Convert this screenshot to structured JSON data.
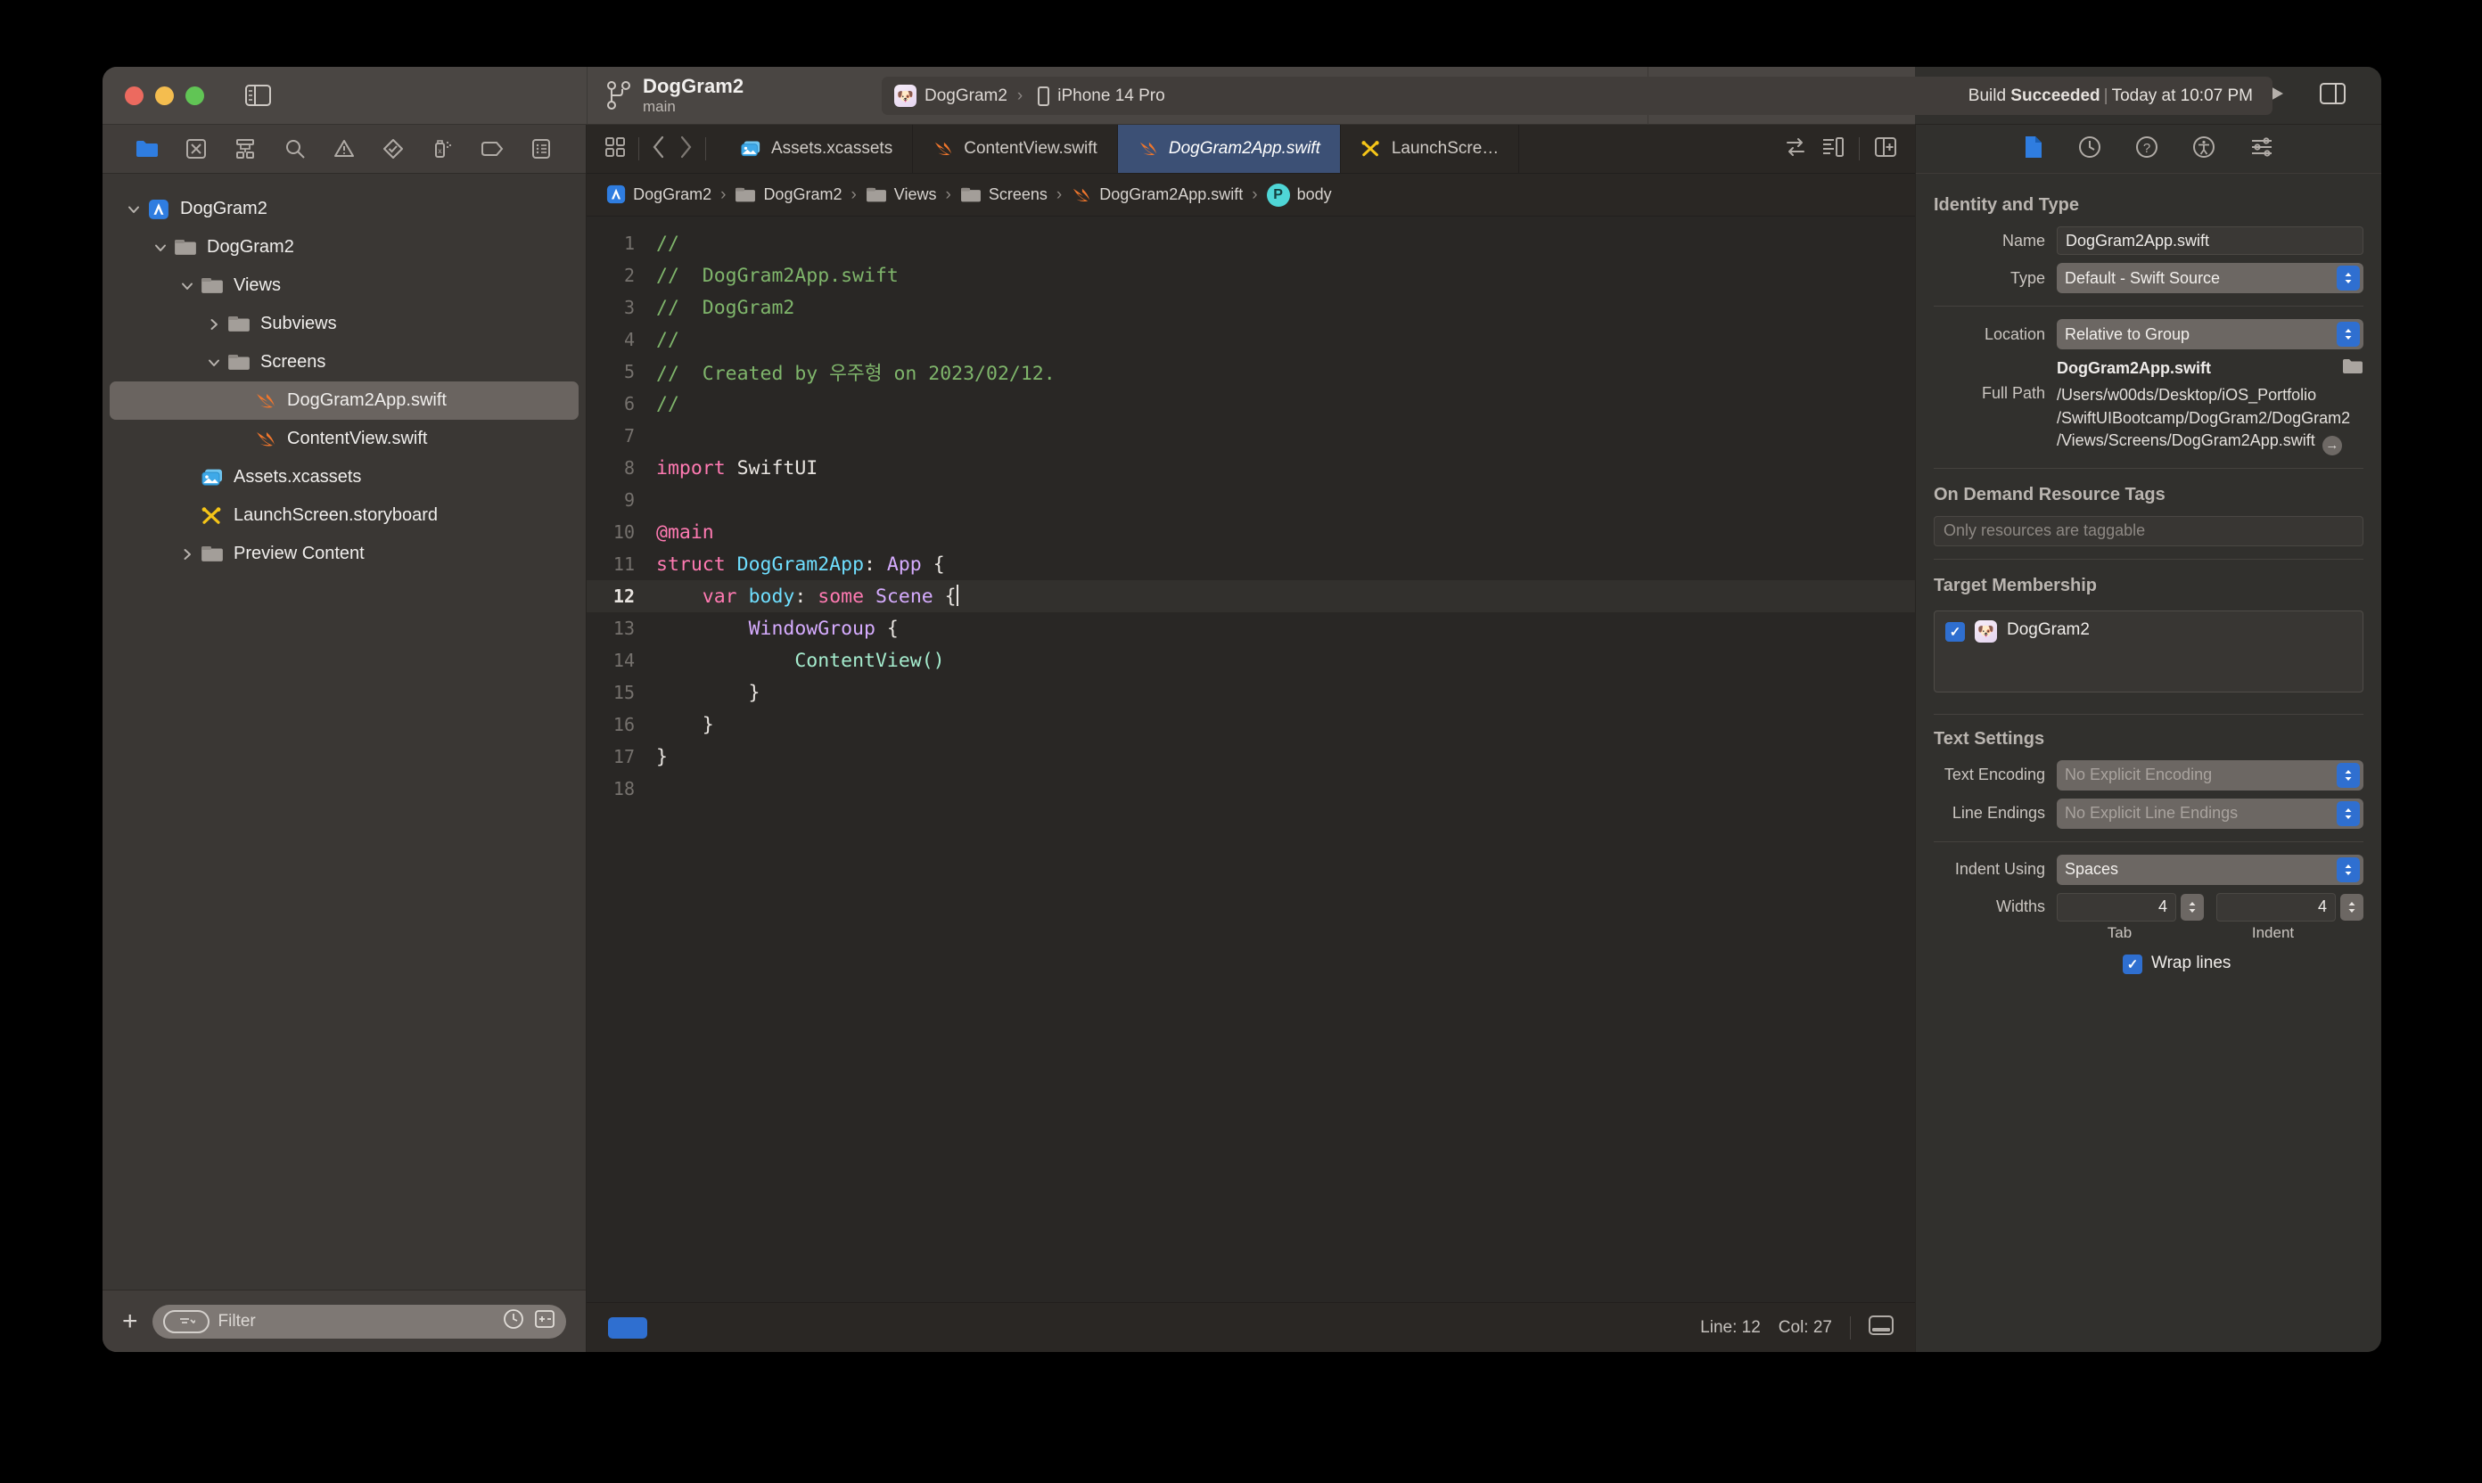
{
  "window": {
    "traffic_lights": [
      "close",
      "minimize",
      "zoom"
    ],
    "sidebar_toggle_icon": "sidebar-left-icon",
    "run_icon": "run-play-icon",
    "add_icon": "plus-icon",
    "inspector_toggle_icon": "sidebar-right-icon"
  },
  "toolbar": {
    "branch_icon": "source-control-branch-icon",
    "project_name": "DogGram2",
    "branch_name": "main",
    "scheme": {
      "app_icon": "doggram2-app-icon",
      "scheme_name": "DogGram2",
      "separator": "›",
      "device_icon": "iphone-device-icon",
      "destination": "iPhone 14 Pro"
    },
    "build_status": {
      "prefix": "Build ",
      "result": "Succeeded",
      "separator": "|",
      "time": "Today at 10:07 PM"
    }
  },
  "navigator": {
    "toolbar_icons": [
      "folder-project-navigator-icon",
      "source-control-navigator-icon",
      "symbol-navigator-icon",
      "find-navigator-icon",
      "issue-navigator-icon",
      "test-navigator-icon",
      "debug-navigator-icon",
      "breakpoint-navigator-icon",
      "report-navigator-icon"
    ],
    "tree": [
      {
        "label": "DogGram2",
        "icon": "xcode-project-icon",
        "twist": "down",
        "depth": 0,
        "selected": false
      },
      {
        "label": "DogGram2",
        "icon": "folder-icon",
        "twist": "down",
        "depth": 1,
        "selected": false
      },
      {
        "label": "Views",
        "icon": "folder-icon",
        "twist": "down",
        "depth": 2,
        "selected": false
      },
      {
        "label": "Subviews",
        "icon": "folder-icon",
        "twist": "right",
        "depth": 3,
        "selected": false
      },
      {
        "label": "Screens",
        "icon": "folder-icon",
        "twist": "down",
        "depth": 3,
        "selected": false
      },
      {
        "label": "DogGram2App.swift",
        "icon": "swift-file-icon",
        "twist": "none",
        "depth": 4,
        "selected": true
      },
      {
        "label": "ContentView.swift",
        "icon": "swift-file-icon",
        "twist": "none",
        "depth": 4,
        "selected": false
      },
      {
        "label": "Assets.xcassets",
        "icon": "assets-catalog-icon",
        "twist": "none",
        "depth": 2,
        "selected": false
      },
      {
        "label": "LaunchScreen.storyboard",
        "icon": "storyboard-icon",
        "twist": "none",
        "depth": 2,
        "selected": false
      },
      {
        "label": "Preview Content",
        "icon": "folder-icon",
        "twist": "right",
        "depth": 2,
        "selected": false
      }
    ],
    "filter": {
      "add_label": "+",
      "placeholder": "Filter",
      "filter_pill_icon": "filter-options-icon",
      "recent_icon": "recent-clock-icon",
      "sourcecontrol_icon": "show-modified-icon"
    }
  },
  "editor": {
    "nav_icons": [
      "grid-editor-options-icon",
      "back-chevron-icon",
      "forward-chevron-icon"
    ],
    "tabs": [
      {
        "label": "Assets.xcassets",
        "icon": "assets-catalog-icon",
        "active": false
      },
      {
        "label": "ContentView.swift",
        "icon": "swift-file-icon",
        "active": false
      },
      {
        "label": "DogGram2App.swift",
        "icon": "swift-file-icon",
        "active": true
      },
      {
        "label": "LaunchScre…",
        "icon": "storyboard-icon",
        "active": false
      }
    ],
    "tab_right_icons": [
      "code-review-toggle-icon",
      "minimap-toggle-icon",
      "add-editor-icon"
    ],
    "breadcrumb": [
      {
        "label": "DogGram2",
        "icon": "xcode-project-icon"
      },
      {
        "label": "DogGram2",
        "icon": "folder-icon"
      },
      {
        "label": "Views",
        "icon": "folder-icon"
      },
      {
        "label": "Screens",
        "icon": "folder-icon"
      },
      {
        "label": "DogGram2App.swift",
        "icon": "swift-file-icon"
      },
      {
        "label": "body",
        "icon": "property-badge-icon"
      }
    ],
    "code_lines": [
      {
        "n": "1",
        "tokens": [
          {
            "t": "//",
            "c": "cmt"
          }
        ],
        "hl": false
      },
      {
        "n": "2",
        "tokens": [
          {
            "t": "//  DogGram2App.swift",
            "c": "cmt"
          }
        ],
        "hl": false
      },
      {
        "n": "3",
        "tokens": [
          {
            "t": "//  DogGram2",
            "c": "cmt"
          }
        ],
        "hl": false
      },
      {
        "n": "4",
        "tokens": [
          {
            "t": "//",
            "c": "cmt"
          }
        ],
        "hl": false
      },
      {
        "n": "5",
        "tokens": [
          {
            "t": "//  Created by 우주형 on 2023/02/12.",
            "c": "cmt"
          }
        ],
        "hl": false
      },
      {
        "n": "6",
        "tokens": [
          {
            "t": "//",
            "c": "cmt"
          }
        ],
        "hl": false
      },
      {
        "n": "7",
        "tokens": [],
        "hl": false
      },
      {
        "n": "8",
        "tokens": [
          {
            "t": "import",
            "c": "kw"
          },
          {
            "t": " SwiftUI",
            "c": "pln"
          }
        ],
        "hl": false
      },
      {
        "n": "9",
        "tokens": [],
        "hl": false
      },
      {
        "n": "10",
        "tokens": [
          {
            "t": "@main",
            "c": "kw"
          }
        ],
        "hl": false
      },
      {
        "n": "11",
        "tokens": [
          {
            "t": "struct",
            "c": "kw"
          },
          {
            "t": " ",
            "c": "pln"
          },
          {
            "t": "DogGram2App",
            "c": "decl"
          },
          {
            "t": ": ",
            "c": "pln"
          },
          {
            "t": "App",
            "c": "typ"
          },
          {
            "t": " {",
            "c": "pln"
          }
        ],
        "hl": false
      },
      {
        "n": "12",
        "tokens": [
          {
            "t": "    ",
            "c": "pln"
          },
          {
            "t": "var",
            "c": "kw"
          },
          {
            "t": " ",
            "c": "pln"
          },
          {
            "t": "body",
            "c": "decl"
          },
          {
            "t": ": ",
            "c": "pln"
          },
          {
            "t": "some",
            "c": "kw"
          },
          {
            "t": " ",
            "c": "pln"
          },
          {
            "t": "Scene",
            "c": "typ"
          },
          {
            "t": " {",
            "c": "pln"
          }
        ],
        "hl": true,
        "caret": true
      },
      {
        "n": "13",
        "tokens": [
          {
            "t": "        ",
            "c": "pln"
          },
          {
            "t": "WindowGroup",
            "c": "typ"
          },
          {
            "t": " {",
            "c": "pln"
          }
        ],
        "hl": false
      },
      {
        "n": "14",
        "tokens": [
          {
            "t": "            ",
            "c": "pln"
          },
          {
            "t": "ContentView",
            "c": "fn"
          },
          {
            "t": "()",
            "c": "fn"
          }
        ],
        "hl": false
      },
      {
        "n": "15",
        "tokens": [
          {
            "t": "        }",
            "c": "pln"
          }
        ],
        "hl": false
      },
      {
        "n": "16",
        "tokens": [
          {
            "t": "    }",
            "c": "pln"
          }
        ],
        "hl": false
      },
      {
        "n": "17",
        "tokens": [
          {
            "t": "}",
            "c": "pln"
          }
        ],
        "hl": false
      },
      {
        "n": "18",
        "tokens": [],
        "hl": false
      }
    ],
    "status": {
      "line_label": "Line: 12",
      "col_label": "Col: 27",
      "debug_toggle_icon": "debug-area-toggle-icon",
      "activity_icon": "activity-indicator-icon"
    }
  },
  "inspector": {
    "tabs": [
      {
        "icon": "file-inspector-icon",
        "active": true
      },
      {
        "icon": "history-inspector-icon",
        "active": false
      },
      {
        "icon": "quick-help-inspector-icon",
        "active": false
      },
      {
        "icon": "accessibility-inspector-icon",
        "active": false
      },
      {
        "icon": "attributes-inspector-icon",
        "active": false
      }
    ],
    "identity": {
      "title": "Identity and Type",
      "name_label": "Name",
      "name_value": "DogGram2App.swift",
      "type_label": "Type",
      "type_value": "Default - Swift Source",
      "location_label": "Location",
      "location_value": "Relative to Group",
      "file_name": "DogGram2App.swift",
      "folder_icon": "choose-folder-icon",
      "fullpath_label": "Full Path",
      "fullpath_value": "/Users/w00ds/Desktop/iOS_Portfolio/SwiftUIBootcamp/DogGram2/DogGram2/Views/Screens/DogGram2App.swift",
      "reveal_icon": "reveal-in-finder-icon"
    },
    "odr": {
      "title": "On Demand Resource Tags",
      "placeholder": "Only resources are taggable"
    },
    "target_membership": {
      "title": "Target Membership",
      "items": [
        {
          "label": "DogGram2",
          "checked": true,
          "icon": "doggram2-app-icon"
        }
      ]
    },
    "text_settings": {
      "title": "Text Settings",
      "encoding_label": "Text Encoding",
      "encoding_value": "No Explicit Encoding",
      "endings_label": "Line Endings",
      "endings_value": "No Explicit Line Endings",
      "indent_label": "Indent Using",
      "indent_value": "Spaces",
      "widths_label": "Widths",
      "tab_value": "4",
      "tab_sublabel": "Tab",
      "indent_width_value": "4",
      "indent_sublabel": "Indent",
      "wrap_label": "Wrap lines",
      "wrap_checked": true
    }
  },
  "colors": {
    "accent_blue": "#2f6fd0",
    "active_tab_blue": "#3c5075",
    "swift_orange": "#f0762c",
    "comment_green": "#7fb56b",
    "keyword_pink": "#ff7ab2",
    "type_purple": "#d6acff",
    "decl_cyan": "#6fdfff"
  }
}
